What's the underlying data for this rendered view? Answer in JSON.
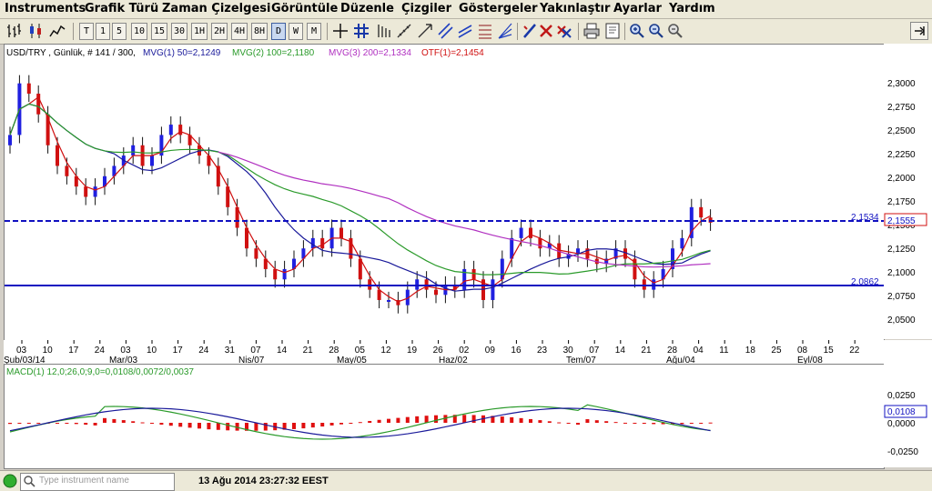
{
  "menu": [
    "Instruments",
    "Grafik Türü",
    "Zaman Çizelgesi",
    "Görüntüle",
    "Düzenle",
    "Çizgiler",
    "Göstergeler",
    "Yakınlaştır",
    "Ayarlar",
    "Yardım"
  ],
  "timeframes": [
    "T",
    "1",
    "5",
    "10",
    "15",
    "30",
    "1H",
    "2H",
    "4H",
    "8H",
    "D",
    "W",
    "M"
  ],
  "selected_timeframe": "D",
  "chart_header": {
    "symbol": "USD/TRY , Günlük, # 141 / 300, ",
    "mvg1": "MVG(1) 50=2,1249",
    "mvg2": "MVG(2) 100=2,1180",
    "mvg3": "MVG(3) 200=2,1334",
    "otf": "OTF(1)=2,1454"
  },
  "colors": {
    "mvg1": "#1a1a9a",
    "mvg2": "#2a9a2a",
    "mvg3": "#b030c0",
    "otf": "#d01010",
    "up": "#2020e0",
    "down": "#d01010"
  },
  "price_axis": [
    "2,3000",
    "2,2750",
    "2,2500",
    "2,2250",
    "2,2000",
    "2,1750",
    "2,1500",
    "2,1250",
    "2,1000",
    "2,0750",
    "2,0500"
  ],
  "price_levels": {
    "upper": "2,1534",
    "lower": "2,0862"
  },
  "current_price": "2,1555",
  "date_axis": [
    "03",
    "10",
    "17",
    "24",
    "03",
    "10",
    "17",
    "24",
    "31",
    "07",
    "14",
    "21",
    "28",
    "05",
    "12",
    "19",
    "26",
    "02",
    "09",
    "16",
    "23",
    "30",
    "07",
    "14",
    "21",
    "28",
    "04",
    "11",
    "18",
    "25",
    "08",
    "15",
    "22"
  ],
  "month_axis": [
    "Şub/03/14",
    "Mar/03",
    "Nis/07",
    "May/05",
    "Haz/02",
    "Tem/07",
    "Ağu/04",
    "Eyl/08"
  ],
  "chart_data": {
    "type": "candlestick",
    "series": [
      {
        "name": "USD/TRY",
        "values": [
          2.24,
          2.29,
          2.28,
          2.26,
          2.23,
          2.21,
          2.2,
          2.19,
          2.18,
          2.19,
          2.2,
          2.21,
          2.22,
          2.23,
          2.21,
          2.22,
          2.24,
          2.25,
          2.24,
          2.23,
          2.22,
          2.21,
          2.19,
          2.17,
          2.15,
          2.13,
          2.12,
          2.11,
          2.1,
          2.11,
          2.12,
          2.13,
          2.14,
          2.13,
          2.15,
          2.14,
          2.12,
          2.1,
          2.09,
          2.08,
          2.08,
          2.075,
          2.09,
          2.1,
          2.09,
          2.085,
          2.095,
          2.09,
          2.11,
          2.1,
          2.08,
          2.1,
          2.12,
          2.14,
          2.15,
          2.14,
          2.13,
          2.135,
          2.12,
          2.125,
          2.13,
          2.12,
          2.115,
          2.12,
          2.13,
          2.12,
          2.1,
          2.09,
          2.1,
          2.11,
          2.13,
          2.14,
          2.17,
          2.16,
          2.155
        ]
      }
    ],
    "indicators": [
      "MVG(1) 50",
      "MVG(2) 100",
      "MVG(3) 200",
      "OTF(1)"
    ],
    "ylim": [
      2.05,
      2.31
    ]
  },
  "macd": {
    "label": "MACD(1) 12,0;26,0;9,0=0,0108/0,0072/0,0037",
    "axis": [
      "0,0250",
      "0,0000",
      "-0,0250"
    ],
    "current": "0,0108"
  },
  "status": {
    "search_placeholder": "Type instrument name",
    "datetime": "13 Ağu 2014 23:27:32 EEST"
  }
}
